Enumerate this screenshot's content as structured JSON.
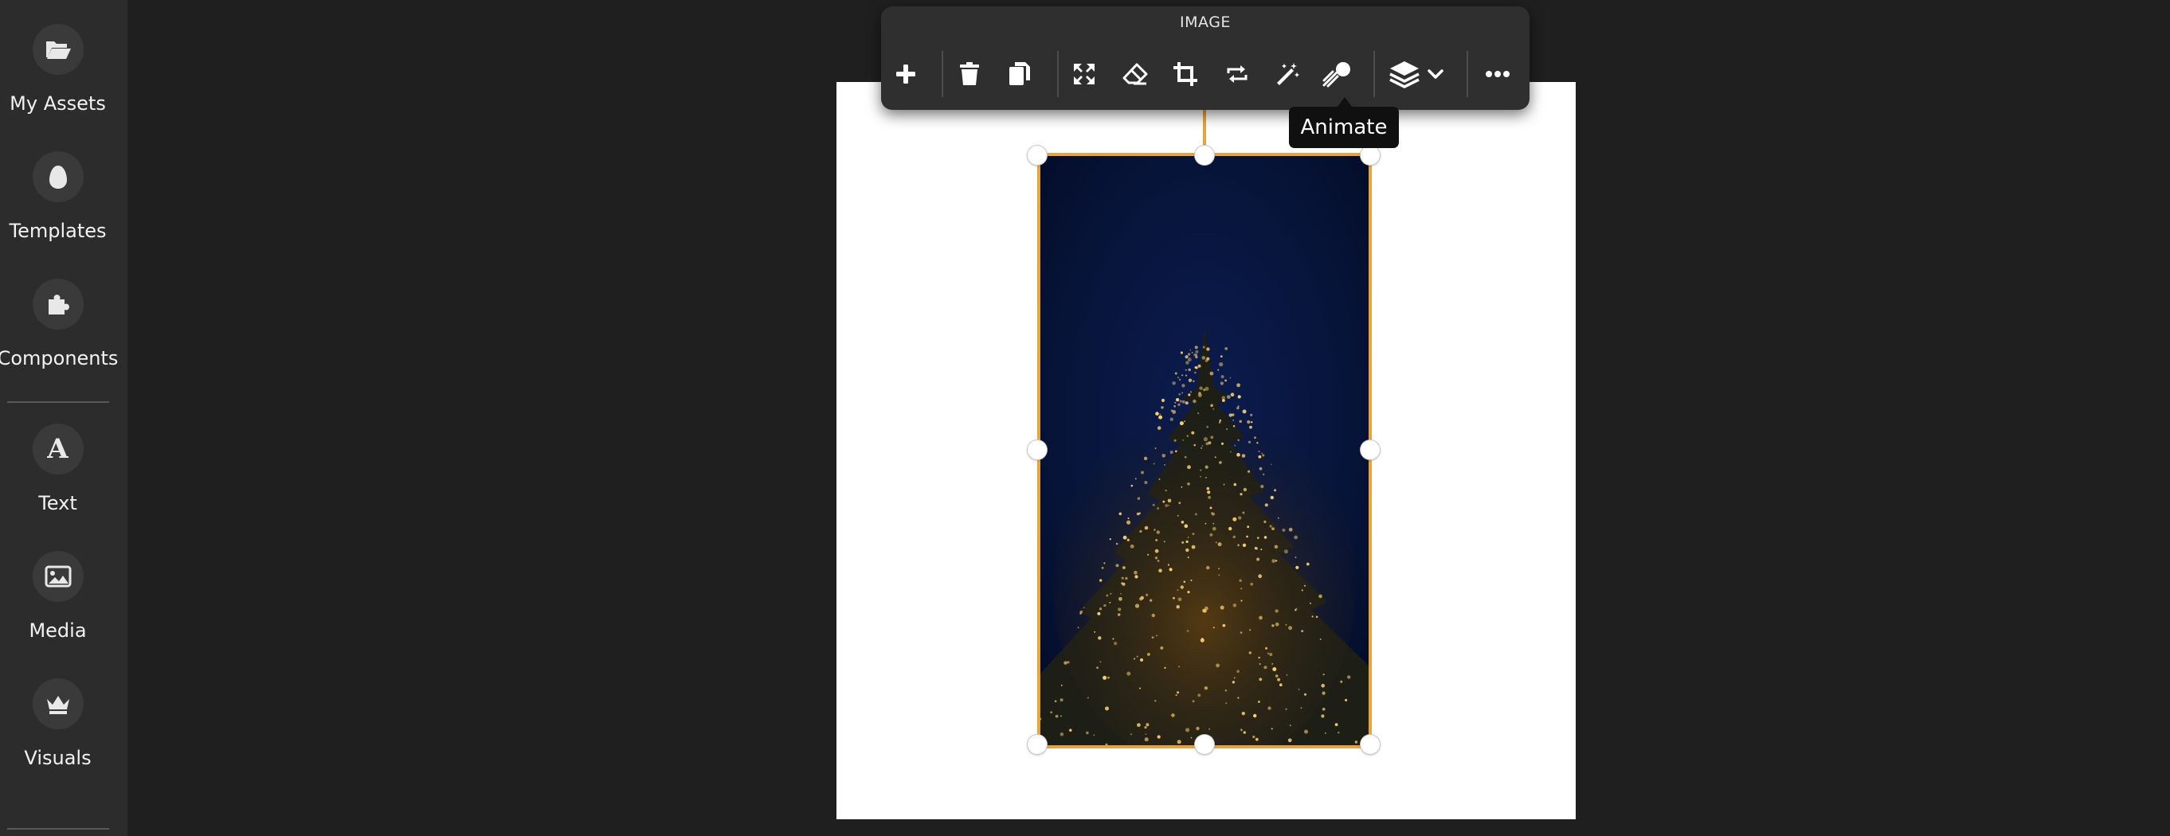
{
  "sidebar": {
    "items": [
      {
        "label": "My Assets",
        "icon": "folder-open-icon"
      },
      {
        "label": "Templates",
        "icon": "egg-icon"
      },
      {
        "label": "Components",
        "icon": "puzzle-icon"
      },
      {
        "label": "Text",
        "icon": "text-a-icon"
      },
      {
        "label": "Media",
        "icon": "image-icon"
      },
      {
        "label": "Visuals",
        "icon": "crown-icon"
      }
    ]
  },
  "toolbar": {
    "title": "IMAGE",
    "buttons": [
      {
        "name": "add",
        "icon": "plus-icon"
      },
      {
        "name": "delete",
        "icon": "trash-icon"
      },
      {
        "name": "duplicate",
        "icon": "copy-icon"
      },
      {
        "name": "fit",
        "icon": "expand-arrows-icon"
      },
      {
        "name": "remove-background",
        "icon": "eraser-icon"
      },
      {
        "name": "crop",
        "icon": "crop-icon"
      },
      {
        "name": "replace",
        "icon": "swap-arrows-icon"
      },
      {
        "name": "effects",
        "icon": "magic-wand-icon"
      },
      {
        "name": "animate",
        "icon": "comet-icon"
      },
      {
        "name": "layers",
        "icon": "layers-icon"
      },
      {
        "name": "more",
        "icon": "ellipsis-icon"
      }
    ]
  },
  "tooltip": {
    "text": "Animate"
  },
  "canvas": {
    "selected_element": "image",
    "image_subject": "christmas tree with lights at night"
  },
  "colors": {
    "app_background": "#1f1f1f",
    "sidebar_background": "#2c2c2c",
    "toolbar_background": "#2f2f2f",
    "selection_border": "#e8a33c",
    "page_background": "#ffffff"
  }
}
